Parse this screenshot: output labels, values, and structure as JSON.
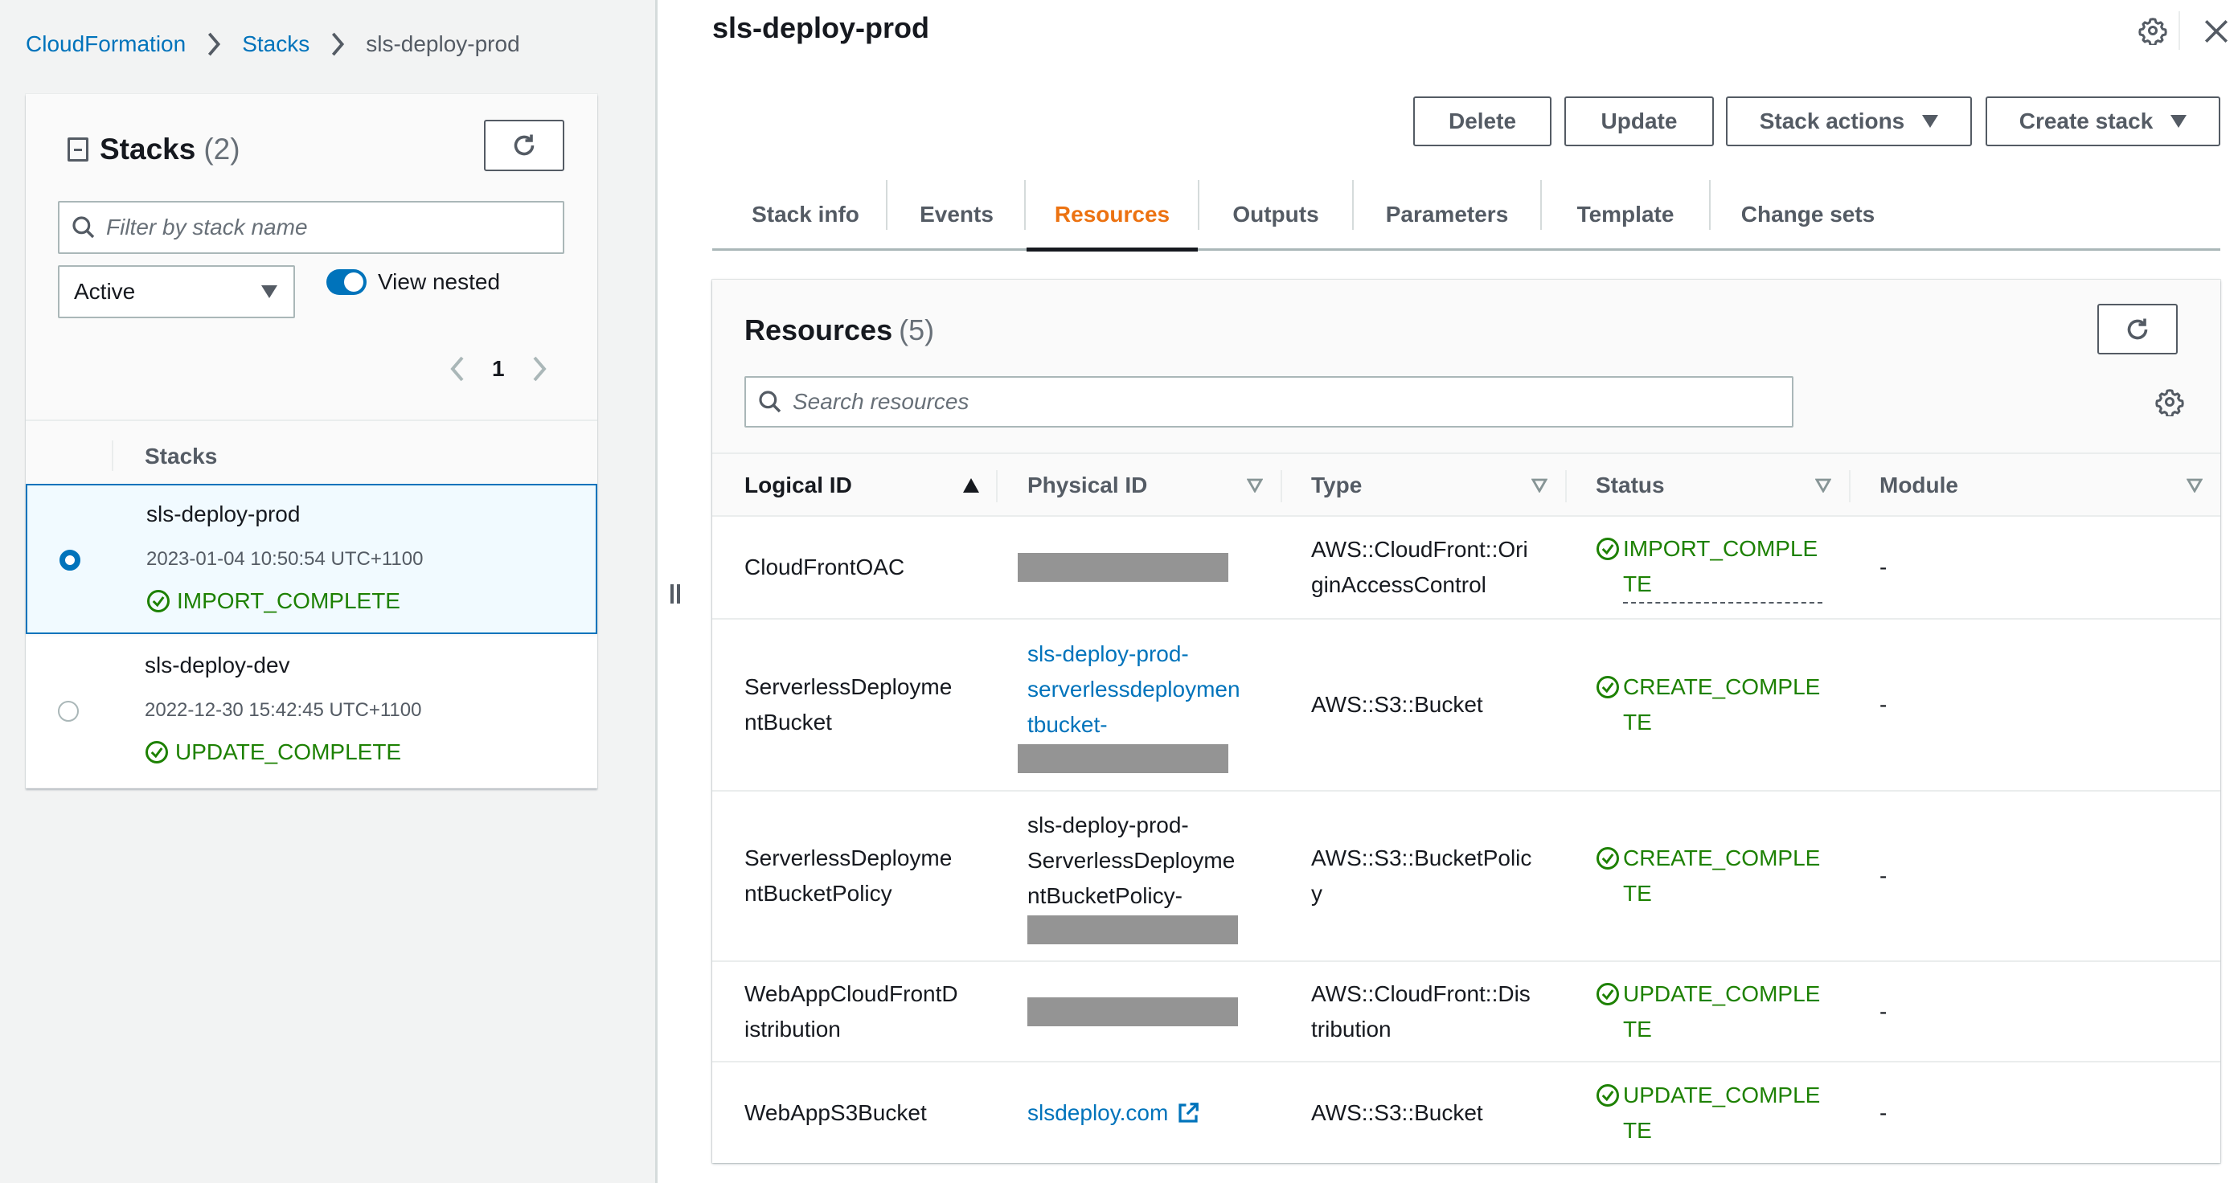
{
  "breadcrumb": {
    "items": [
      "CloudFormation",
      "Stacks"
    ],
    "current": "sls-deploy-prod"
  },
  "stacks_panel": {
    "title": "Stacks",
    "count": "(2)",
    "filter_placeholder": "Filter by stack name",
    "filter_value": "",
    "status_filter": "Active",
    "view_nested_label": "View nested",
    "view_nested_on": true,
    "page": "1",
    "column_header": "Stacks",
    "stacks": [
      {
        "name": "sls-deploy-prod",
        "time": "2023-01-04 10:50:54 UTC+1100",
        "status": "IMPORT_COMPLETE",
        "selected": true
      },
      {
        "name": "sls-deploy-dev",
        "time": "2022-12-30 15:42:45 UTC+1100",
        "status": "UPDATE_COMPLETE",
        "selected": false
      }
    ]
  },
  "detail": {
    "title": "sls-deploy-prod",
    "actions": {
      "delete": "Delete",
      "update": "Update",
      "stack_actions": "Stack actions",
      "create_stack": "Create stack"
    },
    "tabs": [
      {
        "label": "Stack info",
        "active": false
      },
      {
        "label": "Events",
        "active": false
      },
      {
        "label": "Resources",
        "active": true
      },
      {
        "label": "Outputs",
        "active": false
      },
      {
        "label": "Parameters",
        "active": false
      },
      {
        "label": "Template",
        "active": false
      },
      {
        "label": "Change sets",
        "active": false
      }
    ]
  },
  "resources": {
    "title": "Resources",
    "count": "(5)",
    "search_placeholder": "Search resources",
    "search_value": "",
    "columns": [
      "Logical ID",
      "Physical ID",
      "Type",
      "Status",
      "Module"
    ],
    "sorted_column": "Logical ID",
    "sort_direction": "ascending",
    "rows": [
      {
        "logical_id": "CloudFrontOAC",
        "logical_id_wrapped": "CloudFrontOAC",
        "physical_id": "",
        "physical_redacted": true,
        "physical_is_link": false,
        "type": "AWS::CloudFront::Ori\nginAccessControl",
        "status": "IMPORT_COMPLE\nTE",
        "module": "-"
      },
      {
        "logical_id": "ServerlessDeploymentBucket",
        "logical_id_wrapped": "ServerlessDeployme\nntBucket",
        "physical_id": "sls-deploy-prod-\nserverlessdeploymen\ntbucket-",
        "physical_redacted": true,
        "physical_is_link": true,
        "type": "AWS::S3::Bucket",
        "status": "CREATE_COMPLE\nTE",
        "module": "-"
      },
      {
        "logical_id": "ServerlessDeploymentBucketPolicy",
        "logical_id_wrapped": "ServerlessDeployme\nntBucketPolicy",
        "physical_id": "sls-deploy-prod-\nServerlessDeployme\nntBucketPolicy-",
        "physical_redacted": true,
        "physical_is_link": false,
        "type": "AWS::S3::BucketPolic\ny",
        "status": "CREATE_COMPLE\nTE",
        "module": "-"
      },
      {
        "logical_id": "WebAppCloudFrontDistribution",
        "logical_id_wrapped": "WebAppCloudFrontD\nistribution",
        "physical_id": "",
        "physical_redacted": true,
        "physical_is_link": false,
        "type": "AWS::CloudFront::Dis\ntribution",
        "status": "UPDATE_COMPLE\nTE",
        "module": "-"
      },
      {
        "logical_id": "WebAppS3Bucket",
        "logical_id_wrapped": "WebAppS3Bucket",
        "physical_id": "slsdeploy.com",
        "physical_redacted": false,
        "physical_is_link": true,
        "physical_external": true,
        "type": "AWS::S3::Bucket",
        "status": "UPDATE_COMPLE\nTE",
        "module": "-"
      }
    ]
  },
  "colors": {
    "link": "#0073bb",
    "active_tab": "#ec7211",
    "success": "#1d8102",
    "text": "#16191f",
    "secondary_text": "#545b64",
    "panel_bg": "#f2f3f3",
    "selected_row_bg": "#f1faff",
    "redaction": "#949494"
  }
}
